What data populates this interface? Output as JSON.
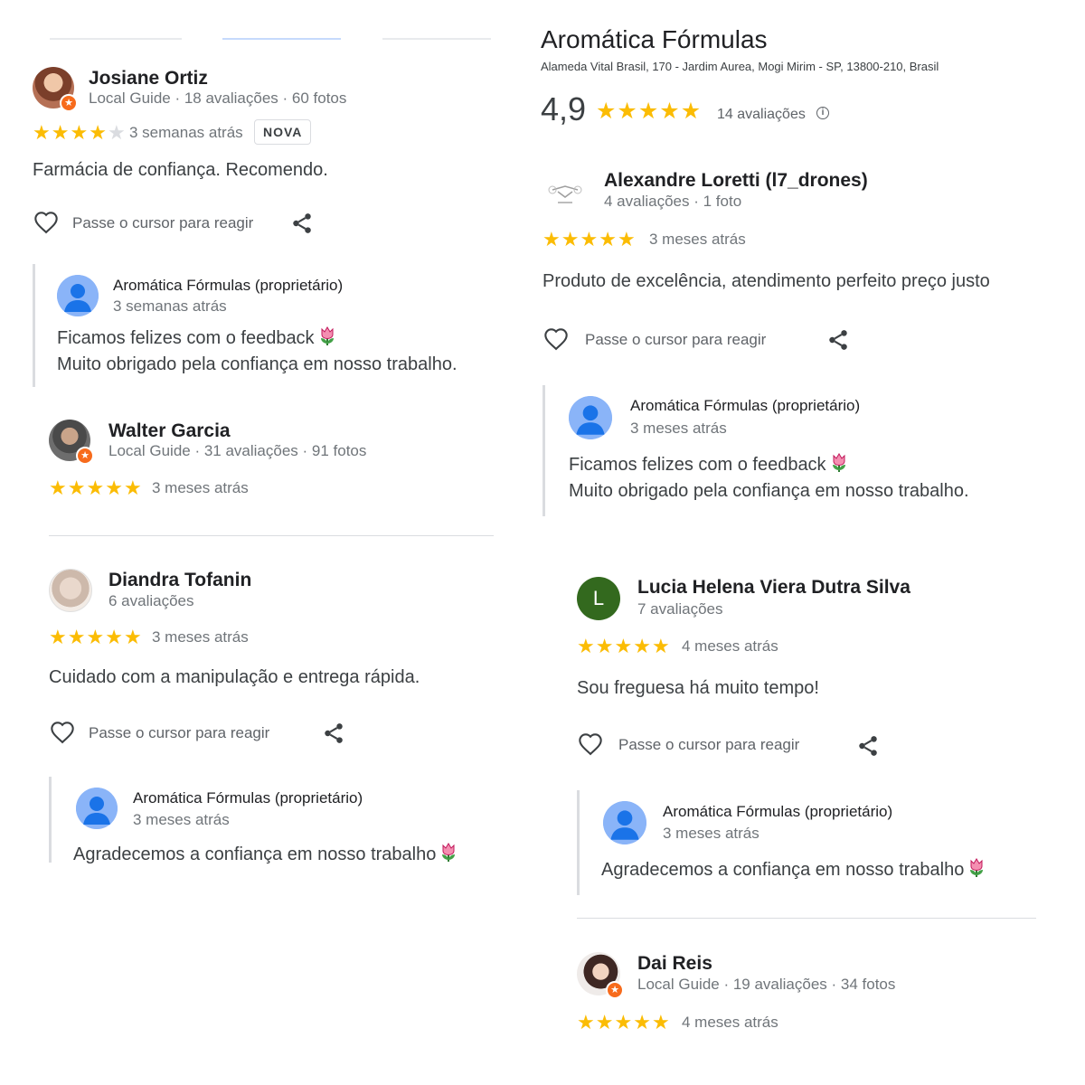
{
  "place": {
    "name": "Aromática Fórmulas",
    "address": "Alameda Vital Brasil, 170 - Jardim Aurea, Mogi Mirim - SP, 13800-210, Brasil",
    "rating": "4,9",
    "rating_stars": 5,
    "reviews_count": "14 avaliações",
    "info_icon": "info-icon"
  },
  "colors": {
    "star": "#fbbc04",
    "star_empty": "#dadce0",
    "owner_avatar": "#8ab4f8",
    "owner_avatar_figure": "#1a73e8",
    "guide_badge": "#f76b1c",
    "letter_avatar": "#33691e"
  },
  "common": {
    "react_label": "Passe o cursor para reagir",
    "owner_name": "Aromática Fórmulas (proprietário)",
    "new_badge": "NOVA",
    "icons": [
      "heart-icon",
      "share-icon",
      "tulip-emoji-icon",
      "local-guide-badge-icon",
      "owner-avatar-icon"
    ]
  },
  "reviews": [
    {
      "name": "Josiane Ortiz",
      "meta": "Local Guide · 18 avaliações · 60 fotos",
      "stars": 4,
      "when": "3 semanas atrás",
      "text": "Farmácia de confiança. Recomendo.",
      "reply": {
        "when": "3 semanas atrás",
        "line1": "Ficamos felizes com o feedback",
        "line2": "Muito obrigado pela confiança em nosso trabalho."
      }
    },
    {
      "name": "Walter Garcia",
      "meta": "Local Guide · 31 avaliações · 91 fotos",
      "stars": 5,
      "when": "3 meses atrás"
    },
    {
      "name": "Diandra Tofanin",
      "meta": "6 avaliações",
      "stars": 5,
      "when": "3 meses atrás",
      "text": "Cuidado com a manipulação e entrega rápida.",
      "reply": {
        "when": "3 meses atrás",
        "line1": "Agradecemos a confiança em nosso trabalho"
      }
    },
    {
      "name": "Alexandre Loretti (l7_drones)",
      "meta": "4 avaliações · 1 foto",
      "stars": 5,
      "when": "3 meses atrás",
      "text": "Produto de excelência, atendimento perfeito preço justo",
      "reply": {
        "when": "3 meses atrás",
        "line1": "Ficamos felizes com o feedback",
        "line2": "Muito obrigado pela confiança em nosso trabalho."
      }
    },
    {
      "name": "Lucia Helena Viera Dutra Silva",
      "avatar_letter": "L",
      "meta": "7 avaliações",
      "stars": 5,
      "when": "4 meses atrás",
      "text": "Sou freguesa há muito tempo!",
      "reply": {
        "when": "3 meses atrás",
        "line1": "Agradecemos a confiança em nosso trabalho"
      }
    },
    {
      "name": "Dai Reis",
      "meta": "Local Guide · 19 avaliações · 34 fotos",
      "stars": 5,
      "when": "4 meses atrás"
    }
  ]
}
